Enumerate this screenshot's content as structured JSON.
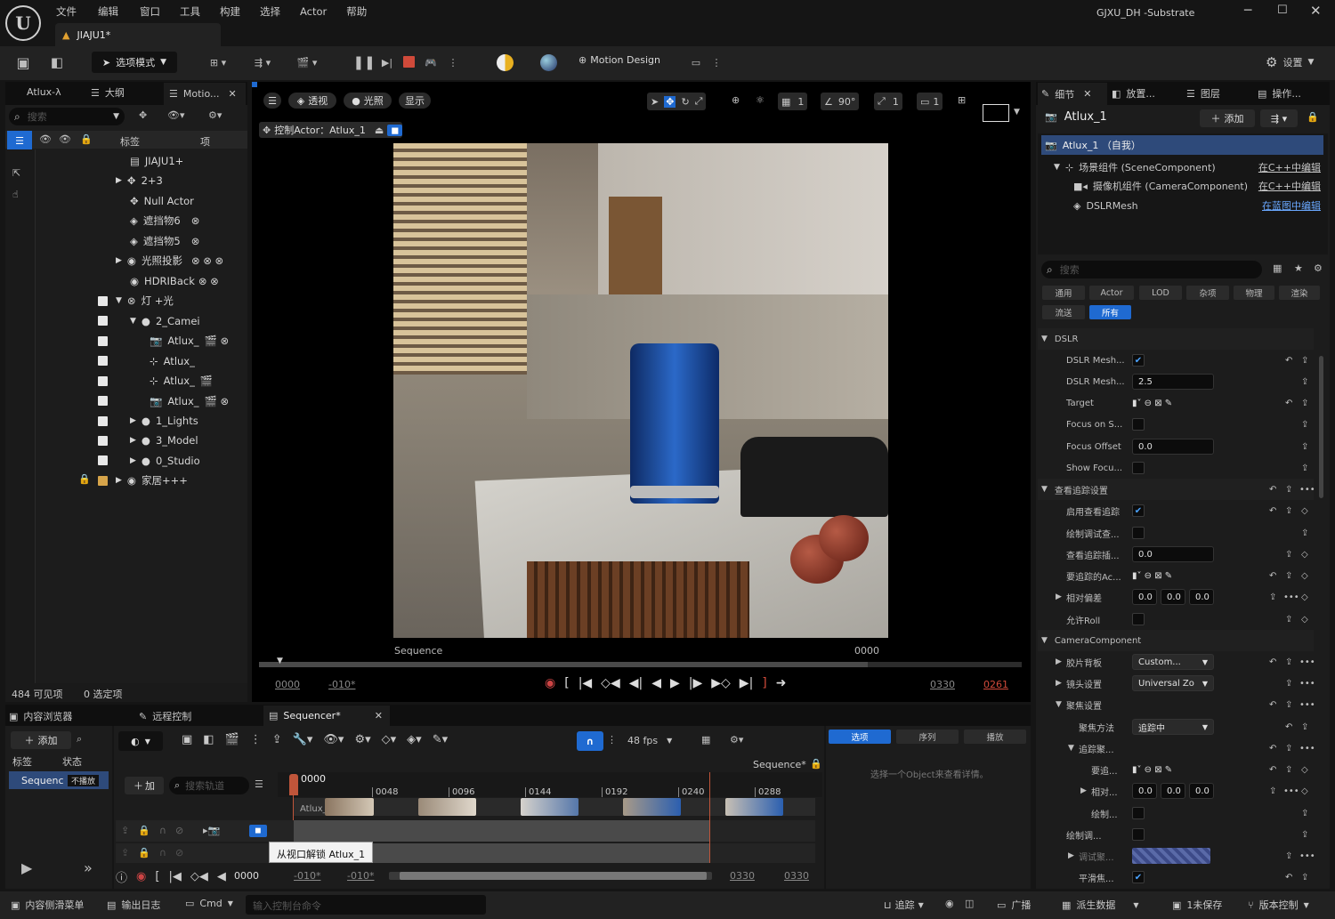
{
  "menu": [
    "文件",
    "编辑",
    "窗口",
    "工具",
    "构建",
    "选择",
    "Actor",
    "帮助"
  ],
  "project_name": "GJXU_DH -Substrate",
  "level_tab": "JIAJU1*",
  "toolbar": {
    "mode": "选项模式",
    "motion_design": "Motion Design",
    "settings": "设置"
  },
  "outliner": {
    "tabs": [
      "Atlux-λ",
      "大纲",
      "Motio..."
    ],
    "search_placeholder": "搜索",
    "col_label": "标签",
    "col_type": "项",
    "items": [
      {
        "label": "JIAJU1+"
      },
      {
        "label": "2+3"
      },
      {
        "label": "Null Actor"
      },
      {
        "label": "遮挡物6"
      },
      {
        "label": "遮挡物5"
      },
      {
        "label": "光照投影"
      },
      {
        "label": "HDRIBack"
      },
      {
        "label": "灯 +光"
      },
      {
        "label": "2_Camei"
      },
      {
        "label": "Atlux_"
      },
      {
        "label": "Atlux_"
      },
      {
        "label": "Atlux_"
      },
      {
        "label": "Atlux_"
      },
      {
        "label": "1_Lights"
      },
      {
        "label": "3_Model"
      },
      {
        "label": "0_Studio"
      },
      {
        "label": "家居+++"
      }
    ],
    "status_count": "484 可见项",
    "status_selected": "0 选定项"
  },
  "viewport": {
    "perspective": "透视",
    "lit": "光照",
    "show": "显示",
    "pilot": "控制Actor：Atlux_1",
    "grid_val": "1",
    "angle_val": "90°",
    "scale_val": "1",
    "cam_speed": "1",
    "seq_label": "Sequence",
    "frame_label": "0000",
    "time_start": "0000",
    "time_neg": "-010*",
    "time_end": "0330",
    "time_end_red": "0261"
  },
  "details": {
    "tabs": [
      "细节",
      "放置...",
      "图层",
      "操作..."
    ],
    "actor_name": "Atlux_1",
    "add_btn": "添加",
    "self_label": "Atlux_1 （自我）",
    "components": [
      {
        "name": "场景组件 (SceneComponent)",
        "link": "在C++中编辑"
      },
      {
        "name": "摄像机组件 (CameraComponent)",
        "link": "在C++中编辑"
      },
      {
        "name": "DSLRMesh",
        "link": "在蓝图中编辑"
      }
    ],
    "search_placeholder": "搜索",
    "filters_row1": [
      "通用",
      "Actor",
      "LOD",
      "杂项",
      "物理",
      "渲染"
    ],
    "filters_row2": [
      "流送",
      "所有"
    ],
    "sec_dslr": "DSLR",
    "p_mesh1": "DSLR Mesh...",
    "p_mesh2": "DSLR Mesh...",
    "p_mesh2_val": "2.5",
    "p_target": "Target",
    "p_focus_on": "Focus on S...",
    "p_focus_offset": "Focus Offset",
    "p_focus_offset_val": "0.0",
    "p_show_focus": "Show Focu...",
    "sec_lookat": "查看追踪设置",
    "p_enable": "启用查看追踪",
    "p_debug": "绘制调试查...",
    "p_interp": "查看追踪插...",
    "p_interp_val": "0.0",
    "p_actor": "要追踪的Ac...",
    "p_offset": "相对偏差",
    "off_x": "0.0",
    "off_y": "0.0",
    "off_z": "0.0",
    "p_roll": "允许Roll",
    "sec_camcomp": "CameraComponent",
    "p_filmback": "胶片背板",
    "filmback_val": "Custom...",
    "p_lens": "镜头设置",
    "lens_val": "Universal Zo",
    "p_focus": "聚焦设置",
    "p_method": "聚焦方法",
    "method_val": "追踪中",
    "p_track": "追踪聚...",
    "p_trk_a": "要追...",
    "p_trk_rel": "相对...",
    "rx": "0.0",
    "ry": "0.0",
    "rz": "0.0",
    "p_draw": "绘制...",
    "p_draw2": "绘制调...",
    "p_dbg_c": "调试聚...",
    "p_smooth": "平滑焦..."
  },
  "sequencer": {
    "panel_tabs": [
      "内容浏览器",
      "远程控制",
      "Sequencer*"
    ],
    "add_btn": "添加",
    "search_placeholder": "搜索",
    "col_label": "标签",
    "col_status": "状态",
    "seq_item": "Sequenc",
    "seq_status": "不播放",
    "fps": "48 fps",
    "seq_name": "Sequence*",
    "add_track": "加",
    "track_search": "搜索轨道",
    "current": "0000",
    "ticks": [
      "0048",
      "0096",
      "0144",
      "0192",
      "0240",
      "0288"
    ],
    "track_name": "Atlux_1",
    "tooltip": "从视口解锁 Atlux_1",
    "bottom_time": "0000",
    "neg1": "-010*",
    "neg2": "-010*",
    "end1": "0330",
    "end2": "0330",
    "right_tabs": [
      "选项",
      "序列",
      "播放"
    ],
    "right_msg": "选择一个Object来查看详情。"
  },
  "statusbar": {
    "drawer": "内容侧滑菜单",
    "log": "输出日志",
    "cmd": "Cmd",
    "cmd_placeholder": "输入控制台命令",
    "trace": "追踪",
    "broadcast": "广播",
    "derived": "派生数据",
    "unsaved": "1未保存",
    "revision": "版本控制"
  }
}
